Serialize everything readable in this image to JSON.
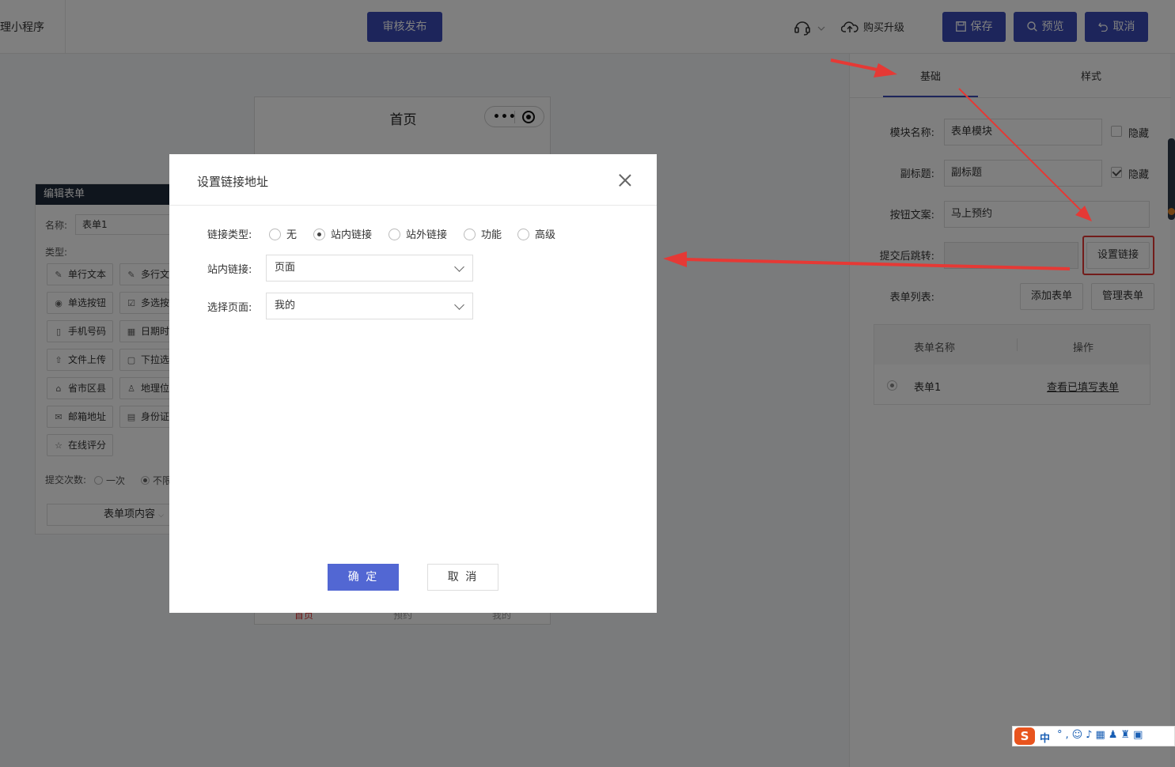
{
  "header": {
    "app_title": "理小程序",
    "publish_label": "审核发布",
    "buy_label": "购买升级",
    "save_label": "保存",
    "preview_label": "预览",
    "cancel_label": "取消"
  },
  "phone": {
    "title": "首页",
    "tabs": [
      "首页",
      "预约",
      "我的"
    ]
  },
  "editor": {
    "header": "编辑表单",
    "name_label": "名称:",
    "name_value": "表单1",
    "type_label": "类型:",
    "types": [
      "单行文本",
      "多行文",
      "单选按钮",
      "多选按",
      "手机号码",
      "日期时",
      "文件上传",
      "下拉选",
      "省市区县",
      "地理位",
      "邮箱地址",
      "身份证",
      "在线评分"
    ],
    "submit_count_label": "提交次数:",
    "submit_once": "一次",
    "submit_unlimited": "不限",
    "form_content_label": "表单项内容"
  },
  "right_panel": {
    "tabs": [
      "基础",
      "样式"
    ],
    "module_name_label": "模块名称:",
    "module_name_value": "表单模块",
    "hide_label": "隐藏",
    "subtitle_label": "副标题:",
    "subtitle_value": "副标题",
    "subtitle_hidden": true,
    "button_text_label": "按钮文案:",
    "button_text_value": "马上预约",
    "jump_label": "提交后跳转:",
    "set_link_label": "设置链接",
    "form_list_label": "表单列表:",
    "add_form_label": "添加表单",
    "manage_form_label": "管理表单",
    "table_headers": [
      "表单名称",
      "操作"
    ],
    "rows": [
      {
        "name": "表单1",
        "action": "查看已填写表单"
      }
    ]
  },
  "modal": {
    "title": "设置链接地址",
    "link_type_label": "链接类型:",
    "link_types": [
      "无",
      "站内链接",
      "站外链接",
      "功能",
      "高级"
    ],
    "selected_link_type": "站内链接",
    "internal_link_label": "站内链接:",
    "internal_link_value": "页面",
    "select_page_label": "选择页面:",
    "select_page_value": "我的",
    "ok_label": "确 定",
    "cancel_label": "取 消"
  },
  "ime": {
    "logo": "S",
    "mode": "中"
  },
  "colors": {
    "primary": "#3b4bb6",
    "modal_ok": "#5267d3",
    "annotation": "#e53935"
  }
}
